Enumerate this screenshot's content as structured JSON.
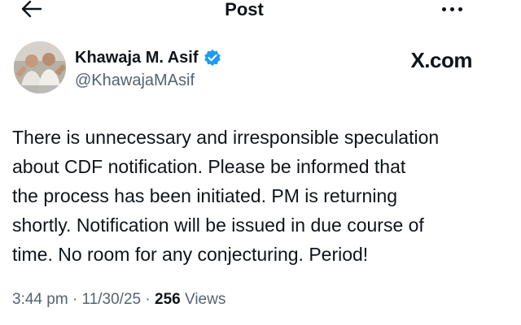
{
  "header": {
    "title": "Post",
    "back_icon": "arrow-left-icon",
    "more_icon": "more-horizontal-icon"
  },
  "author": {
    "name": "Khawaja M. Asif",
    "handle": "@KhawajaMAsif",
    "verified": true,
    "verified_color": "#1d9bf0"
  },
  "brand": "X.com",
  "post": {
    "lines": [
      "There is unnecessary and irresponsible speculation",
      "about CDF notification. Please be informed that",
      "the process has been initiated. PM is returning",
      "shortly. Notification will be issued in due course of",
      "time. No room for any conjecturing. Period!"
    ]
  },
  "meta": {
    "time": "3:44 pm",
    "date": "11/30/25",
    "views_count": "256",
    "views_label": "Views"
  }
}
